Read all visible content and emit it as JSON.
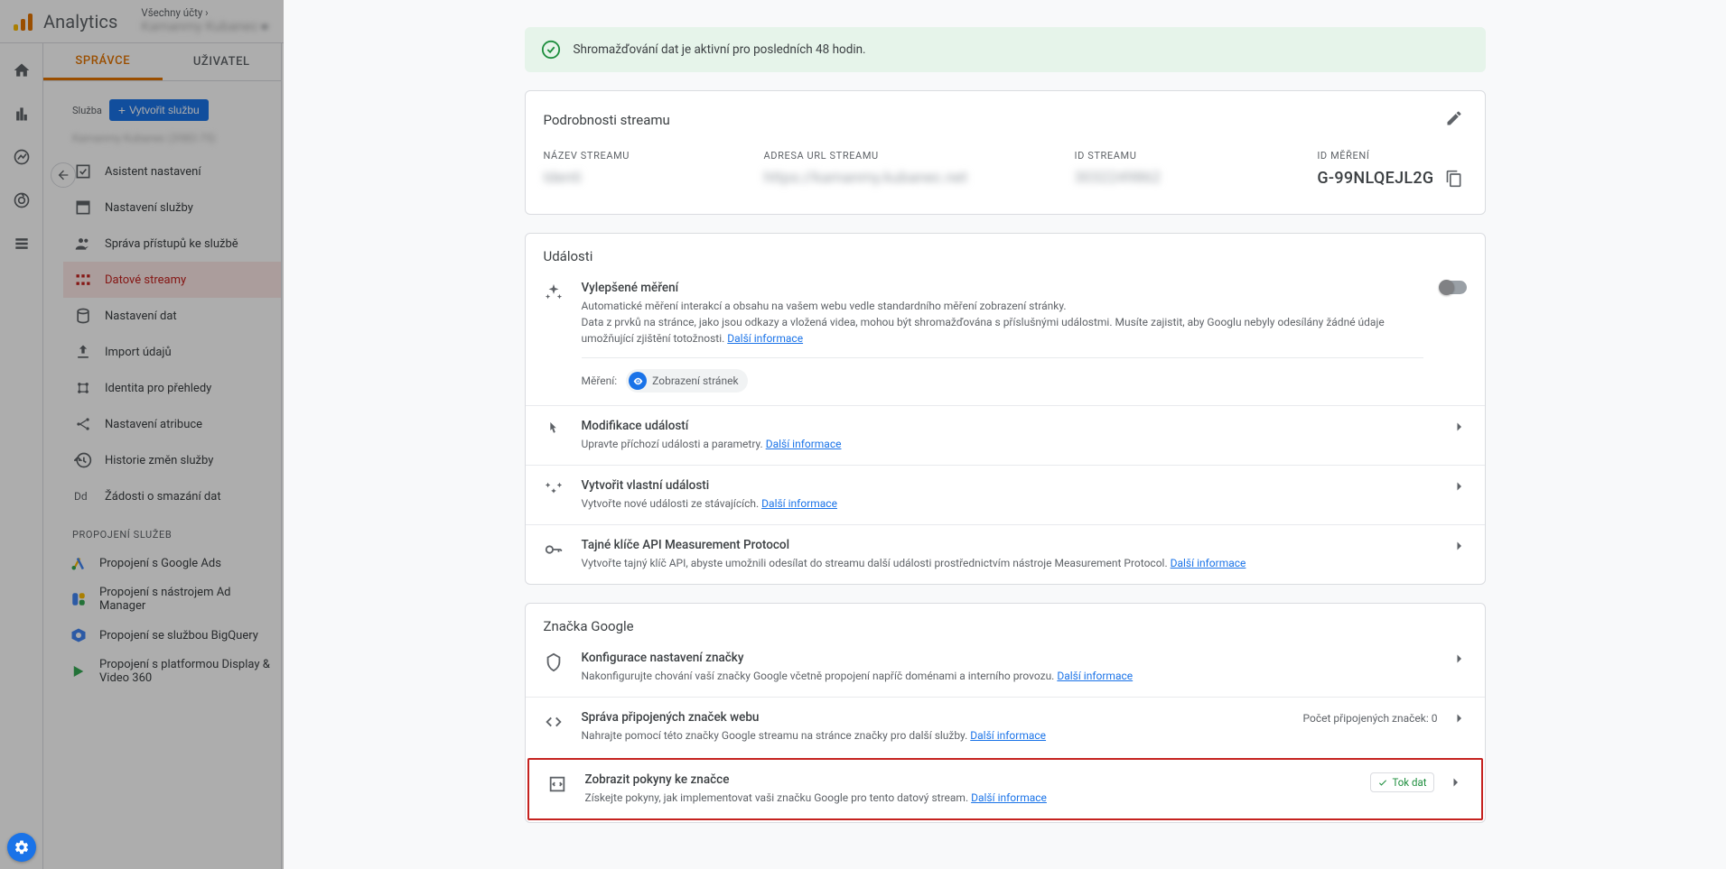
{
  "header": {
    "product": "Analytics",
    "all_accounts": "Všechny účty ›",
    "account_blurred": "Kamanmy Kubanec"
  },
  "tabs": {
    "admin": "SPRÁVCE",
    "user": "UŽIVATEL"
  },
  "property": {
    "label": "Služba",
    "create": "Vytvořit službu",
    "name_blurred": "Kamanmy Kubanec (3582-75)"
  },
  "nav": {
    "assistant": "Asistent nastavení",
    "settings": "Nastavení služby",
    "access": "Správa přístupů ke službě",
    "streams": "Datové streamy",
    "data": "Nastavení dat",
    "import": "Import údajů",
    "identity": "Identita pro přehledy",
    "attribution": "Nastavení atribuce",
    "history": "Historie změn služby",
    "deletion_prefix": "Dd",
    "deletion": "Žádosti o smazání dat"
  },
  "section_link_label": "PROPOJENÍ SLUŽEB",
  "links": {
    "ads": "Propojení s Google Ads",
    "adm": "Propojení s nástrojem Ad Manager",
    "bq": "Propojení se službou BigQuery",
    "dv": "Propojení s platformou Display & Video 360"
  },
  "banner": "Shromažďování dat je aktivní pro posledních 48 hodin.",
  "stream": {
    "title": "Podrobnosti streamu",
    "name_label": "NÁZEV STREAMU",
    "name_value": "Identi",
    "url_label": "ADRESA URL STREAMU",
    "url_value": "https://kamanmy.kubanec.net",
    "id_label": "ID STREAMU",
    "id_value": "3032249862",
    "measurement_label": "ID MĚŘENÍ",
    "measurement_value": "G-99NLQEJL2G"
  },
  "events": {
    "title": "Události",
    "enhanced": {
      "title": "Vylepšené měření",
      "desc1": "Automatické měření interakcí a obsahu na vašem webu vedle standardního měření zobrazení stránky.",
      "desc2": "Data z prvků na stránce, jako jsou odkazy a vložená videa, mohou být shromažďována s příslušnými událostmi. Musíte zajistit, aby Googlu nebyly odesílány žádné údaje umožňující zjištění totožnosti.",
      "more": "Další informace",
      "measure_label": "Měření:",
      "chip_label": "Zobrazení stránek"
    },
    "modify": {
      "title": "Modifikace událostí",
      "sub": "Upravte příchozí události a parametry.",
      "more": "Další informace"
    },
    "custom": {
      "title": "Vytvořit vlastní události",
      "sub": "Vytvořte nové události ze stávajících.",
      "more": "Další informace"
    },
    "secrets": {
      "title": "Tajné klíče API Measurement Protocol",
      "sub": "Vytvořte tajný klíč API, abyste umožnili odesílat do streamu další události prostřednictvím nástroje Measurement Protocol.",
      "more": "Další informace"
    }
  },
  "tag": {
    "title": "Značka Google",
    "config": {
      "title": "Konfigurace nastavení značky",
      "sub": "Nakonfigurujte chování vaší značky Google včetně propojení napříč doménami a interního provozu.",
      "more": "Další informace"
    },
    "linked": {
      "title": "Správa připojených značek webu",
      "sub": "Nahrajte pomocí této značky Google streamu na stránce značky pro další služby.",
      "more": "Další informace",
      "count_label": "Počet připojených značek: 0"
    },
    "instructions": {
      "title": "Zobrazit pokyny ke značce",
      "sub": "Získejte pokyny, jak implementovat vaši značku Google pro tento datový stream.",
      "more": "Další informace",
      "badge": "Tok dat"
    }
  }
}
